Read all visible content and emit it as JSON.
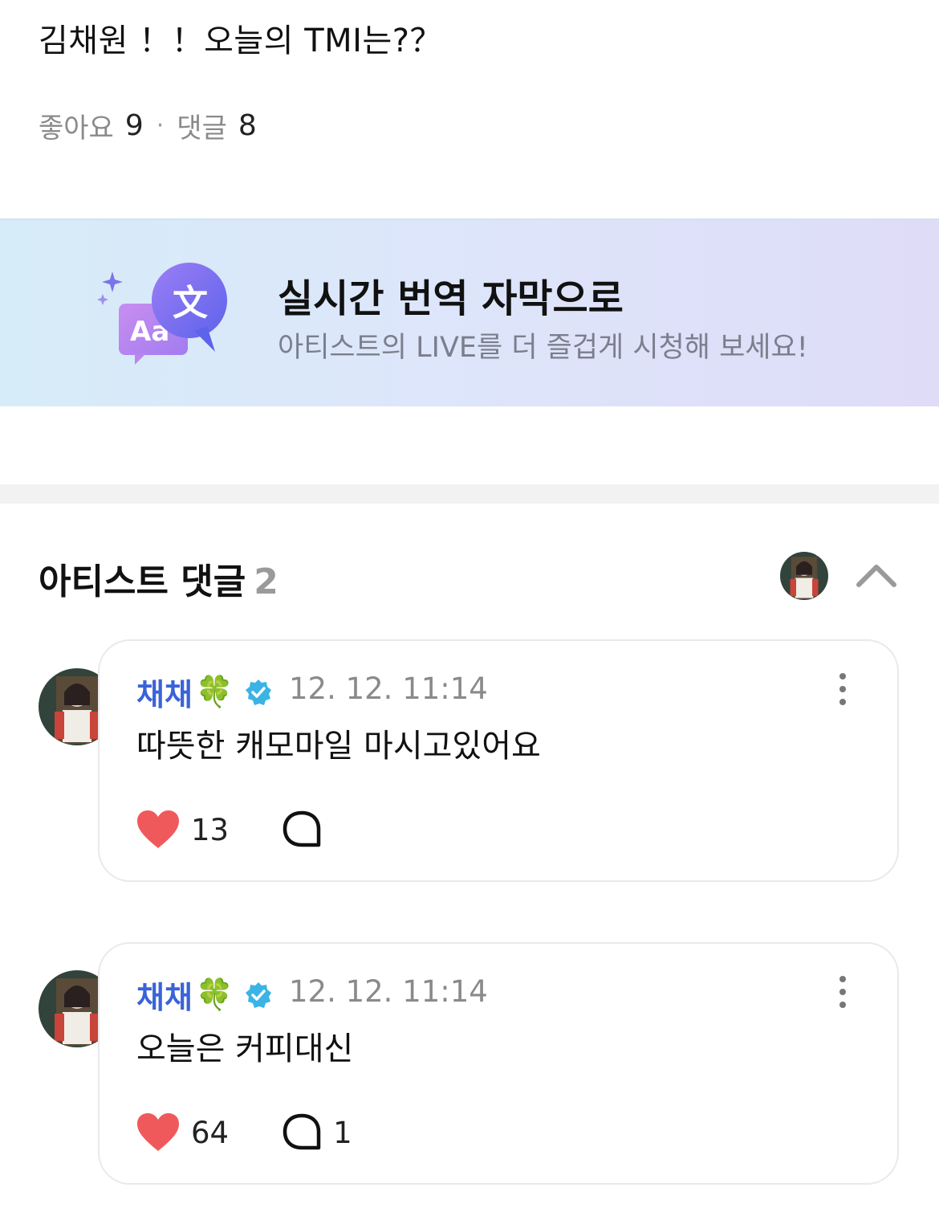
{
  "post": {
    "title": "김채원 ！！오늘의 TMI는?？",
    "likes_label": "좋아요",
    "likes_count": "9",
    "separator": "·",
    "comments_label": "댓글",
    "comments_count": "8"
  },
  "banner": {
    "icon_badge_text": "文",
    "icon_card_text": "Aa",
    "title": "실시간 번역 자막으로",
    "subtitle": "아티스트의 LIVE를 더 즐겁게 시청해 보세요!"
  },
  "artist_comments": {
    "title": "아티스트 댓글",
    "count": "2",
    "comments": [
      {
        "author": "채채",
        "author_emoji": "🍀",
        "timestamp": "12. 12. 11:14",
        "text": "따뜻한 캐모마일 마시고있어요",
        "likes": "13",
        "replies": ""
      },
      {
        "author": "채채",
        "author_emoji": "🍀",
        "timestamp": "12. 12. 11:14",
        "text": "오늘은 커피대신",
        "likes": "64",
        "replies": "1"
      }
    ]
  },
  "colors": {
    "author": "#3a63d8",
    "verified": "#3bb4e5",
    "heart": "#f0595b",
    "banner_accent": "#7a6cf0"
  },
  "icons": [
    "sparkle-icon",
    "translate-icon",
    "chevron-up-icon",
    "verified-badge-icon",
    "more-vertical-icon",
    "heart-icon",
    "comment-bubble-icon"
  ]
}
